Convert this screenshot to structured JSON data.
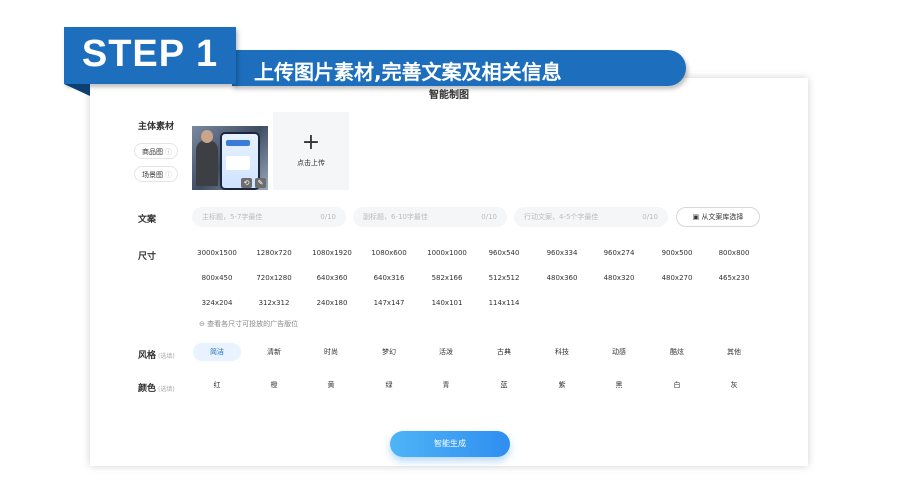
{
  "step": {
    "label": "STEP 1",
    "title": "上传图片素材,完善文案及相关信息"
  },
  "card": {
    "title": "智能制图"
  },
  "material": {
    "label": "主体素材",
    "tabs": [
      {
        "label": "商品图"
      },
      {
        "label": "场景图"
      }
    ],
    "thumb_buttons": [
      "⟲",
      "✎"
    ],
    "upload": {
      "icon": "plus-icon",
      "label": "点击上传"
    }
  },
  "copy": {
    "label": "文案",
    "inputs": [
      {
        "placeholder": "主标题，5-7字最佳",
        "count": "0/10"
      },
      {
        "placeholder": "副标题，6-10字最佳",
        "count": "0/10"
      },
      {
        "placeholder": "行动文案，4-5个字最佳",
        "count": "0/10"
      }
    ],
    "library_button": "从文案库选择"
  },
  "size": {
    "label": "尺寸",
    "rows": [
      [
        "3000x1500",
        "1280x720",
        "1080x1920",
        "1080x600",
        "1000x1000",
        "960x540",
        "960x334",
        "960x274",
        "900x500",
        "800x800"
      ],
      [
        "800x450",
        "720x1280",
        "640x360",
        "640x316",
        "582x166",
        "512x512",
        "480x360",
        "480x320",
        "480x270",
        "465x230"
      ],
      [
        "324x204",
        "312x312",
        "240x180",
        "147x147",
        "140x101",
        "114x114"
      ]
    ],
    "hint": "查看各尺寸可投放的广告版位"
  },
  "style": {
    "label": "风格",
    "optional": "(选填)",
    "options": [
      "简洁",
      "清新",
      "时尚",
      "梦幻",
      "活泼",
      "古典",
      "科技",
      "动感",
      "酷炫",
      "其他"
    ],
    "selected": "简洁"
  },
  "color": {
    "label": "颜色",
    "optional": "(选填)",
    "options": [
      "红",
      "橙",
      "黄",
      "绿",
      "青",
      "蓝",
      "紫",
      "黑",
      "白",
      "灰"
    ]
  },
  "generate_button": "智能生成",
  "colors": {
    "brand": "#1d6fbd",
    "button": "#2f8ef0",
    "active_chip_bg": "#e8f3ff"
  }
}
